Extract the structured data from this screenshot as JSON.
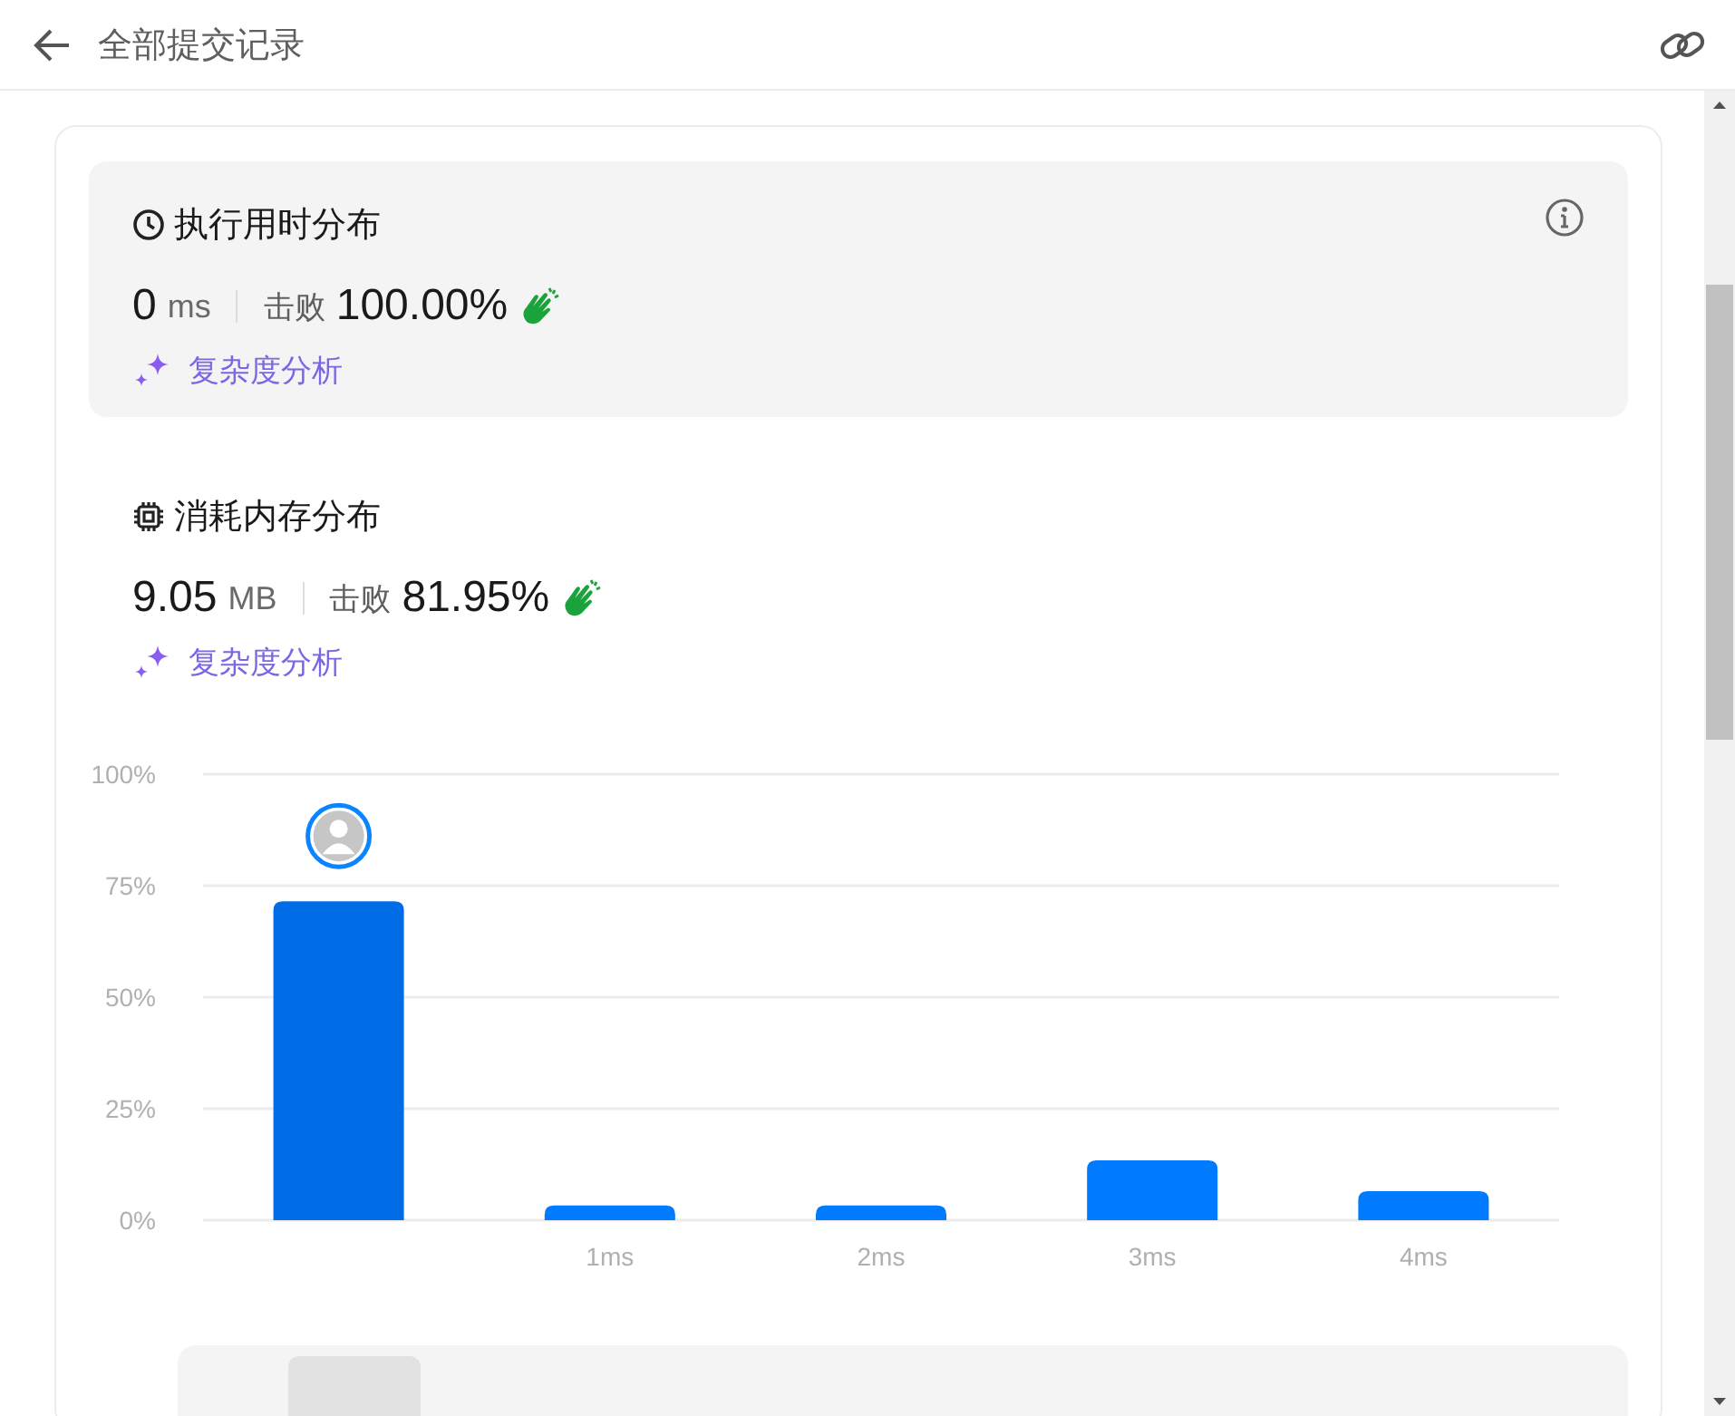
{
  "header": {
    "title": "全部提交记录"
  },
  "stats": [
    {
      "kind": "time",
      "title": "执行用时分布",
      "selected": true,
      "value": "0",
      "unit": "ms",
      "beat_label": "击败",
      "beat": "100.00%",
      "analysis": "复杂度分析"
    },
    {
      "kind": "memory",
      "title": "消耗内存分布",
      "selected": false,
      "value": "9.05",
      "unit": "MB",
      "beat_label": "击败",
      "beat": "81.95%",
      "analysis": "复杂度分析"
    }
  ],
  "chart_data": {
    "type": "bar",
    "categories": [
      null,
      "1ms",
      "2ms",
      "3ms",
      "4ms"
    ],
    "series": [
      {
        "color": "#006ce6",
        "values": [
          71.5,
          null,
          null,
          null,
          null
        ]
      },
      {
        "color": "#007aff",
        "values": [
          null,
          3.3,
          3.3,
          13.4,
          6.5
        ]
      }
    ],
    "grid": true,
    "ylim": [
      0,
      100
    ],
    "yticks": [
      {
        "value": 0,
        "label": "0%"
      },
      {
        "value": 25,
        "label": "25%"
      },
      {
        "value": 50,
        "label": "50%"
      },
      {
        "value": 75,
        "label": "75%"
      },
      {
        "value": 100,
        "label": "100%"
      }
    ]
  }
}
